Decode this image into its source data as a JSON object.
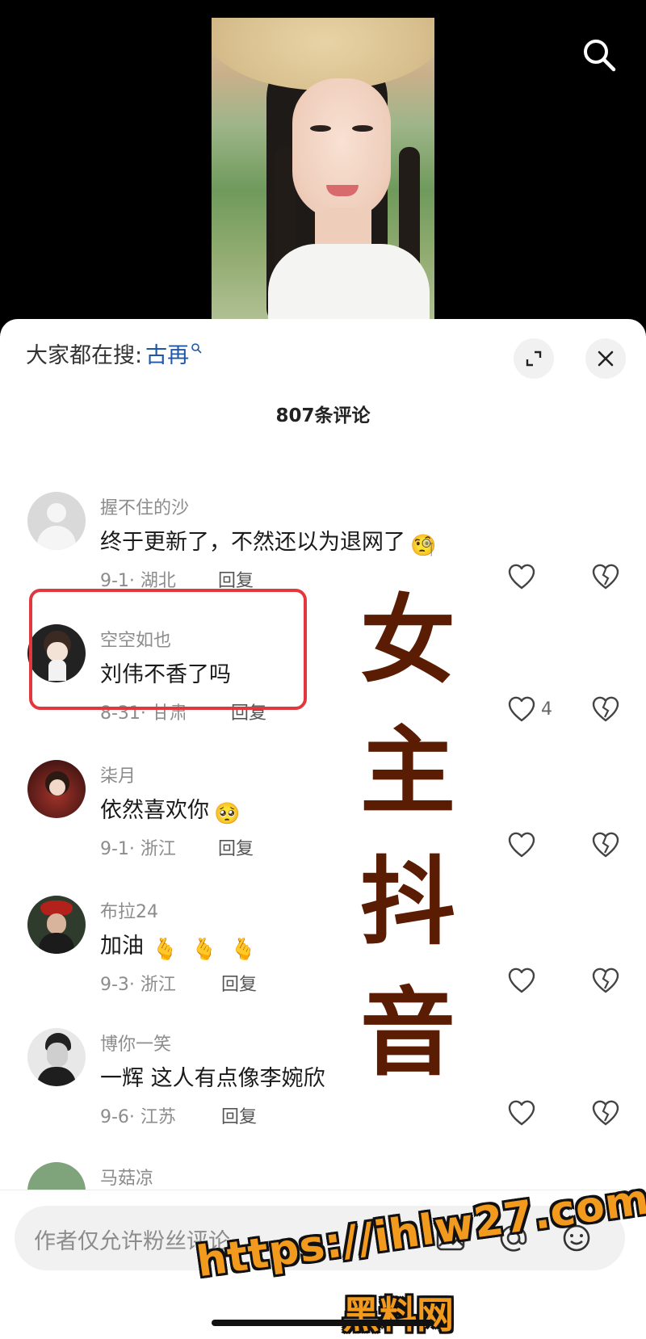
{
  "header": {
    "search_icon": "search-icon"
  },
  "sheet": {
    "trending_prefix": "大家都在搜:",
    "trending_keyword": "古再",
    "comment_count": "807条评论"
  },
  "comments": [
    {
      "username": "握不住的沙",
      "text": "终于更新了，不然还以为退网了",
      "emoji": "🧐",
      "date_location": "9-1· 湖北",
      "reply_label": "回复",
      "likes": ""
    },
    {
      "username": "空空如也",
      "text": "刘伟不香了吗",
      "emoji": "",
      "date_location": "8-31· 甘肃",
      "reply_label": "回复",
      "likes": "4"
    },
    {
      "username": "柒月",
      "text": "依然喜欢你",
      "emoji": "🥺",
      "date_location": "9-1· 浙江",
      "reply_label": "回复",
      "likes": ""
    },
    {
      "username": "布拉24",
      "text": "加油",
      "emoji": "🫰 🫰 🫰",
      "date_location": "9-3· 浙江",
      "reply_label": "回复",
      "likes": ""
    },
    {
      "username": "博你一笑",
      "text": "一辉  这人有点像李婉欣",
      "emoji": "",
      "date_location": "9-6· 江苏",
      "reply_label": "回复",
      "likes": ""
    },
    {
      "username": "马菇凉",
      "text": "",
      "emoji": "",
      "date_location": "",
      "reply_label": "",
      "likes": ""
    }
  ],
  "overlay": {
    "chars": [
      "女",
      "主",
      "抖",
      "音"
    ]
  },
  "input": {
    "placeholder": "作者仅允许粉丝评论"
  },
  "watermark": {
    "url": "https://ihlw27.com",
    "site": "黑料网"
  },
  "colors": {
    "link": "#1f57a8",
    "highlight": "#e2373c",
    "overlay_text": "#5a1d04",
    "watermark": "#f29a1e"
  }
}
